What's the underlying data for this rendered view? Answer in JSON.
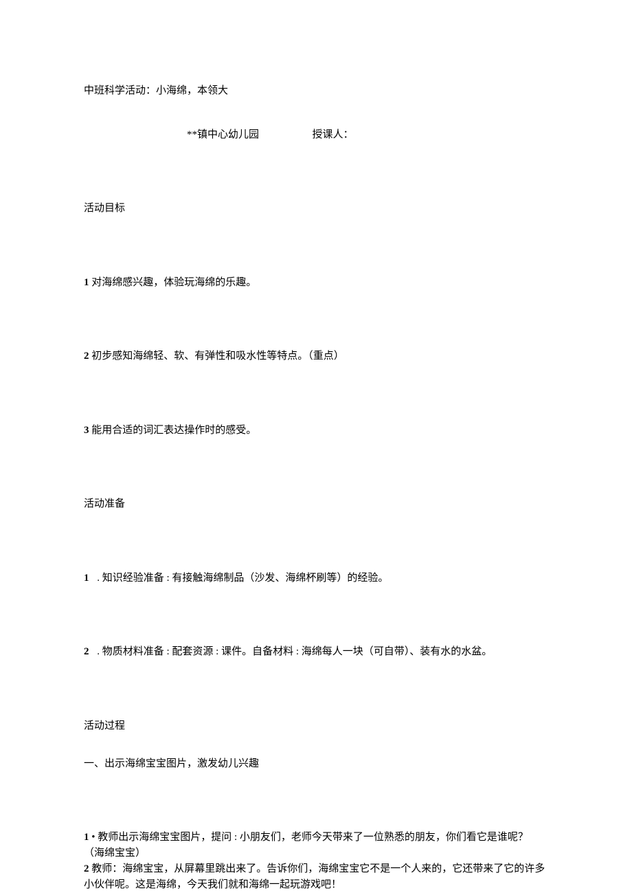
{
  "title": "中班科学活动：小海绵，本领大",
  "subtitle_org": "**镇中心幼儿园",
  "subtitle_presenter_label": "授课人：",
  "section_goals": "活动目标",
  "goal1_num": "1",
  "goal1_text": " 对海绵感兴趣，体验玩海绵的乐趣。",
  "goal2_num": "2",
  "goal2_text": " 初步感知海绵轻、软、有弹性和吸水性等特点。（重点）",
  "goal3_num": "3",
  "goal3_text": " 能用合适的词汇表达操作时的感受。",
  "section_prep": "活动准备",
  "prep1_num": "1",
  "prep1_text": " . 知识经验准备 : 有接触海绵制品（沙发、海绵杯刷等）的经验。",
  "prep2_num": "2",
  "prep2_text": " . 物质材料准备 : 配套资源 : 课件。自备材料 : 海绵每人一块（可自带）、装有水的水盆。",
  "section_process": "活动过程",
  "process_sub1": "一、出示海绵宝宝图片，激发幼儿兴趣",
  "dialog1_num": "1",
  "dialog1_text": " • 教师出示海绵宝宝图片，提问 : 小朋友们，老师今天带来了一位熟悉的朋友，你们看它是谁呢？（海绵宝宝）",
  "dialog2_num": "2",
  "dialog2_text": " 教师：海绵宝宝，从屏幕里跳出来了。告诉你们，海绵宝宝它不是一个人来的，它还带来了它的许多小伙伴呢。这是海绵，今天我们就和海绵一起玩游戏吧！"
}
